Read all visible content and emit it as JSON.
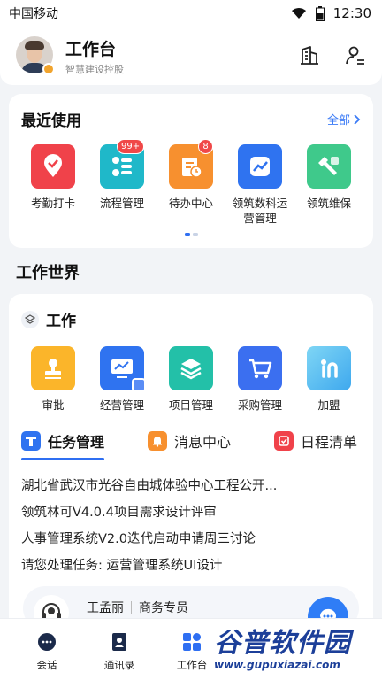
{
  "status_bar": {
    "carrier": "中国移动",
    "time": "12:30"
  },
  "header": {
    "title": "工作台",
    "subtitle": "智慧建设控股",
    "icons": [
      "building-switch-icon",
      "user-settings-icon"
    ]
  },
  "recent": {
    "title": "最近使用",
    "more_label": "全部",
    "apps": [
      {
        "label": "考勤打卡",
        "icon": "location-check-icon",
        "color": "#f0424a",
        "badge": ""
      },
      {
        "label": "流程管理",
        "icon": "flow-icon",
        "color": "#1fb8c9",
        "badge": "99+"
      },
      {
        "label": "待办中心",
        "icon": "clipboard-clock-icon",
        "color": "#f7902f",
        "badge": "8"
      },
      {
        "label": "领筑数科运营管理",
        "icon": "chart-icon",
        "color": "#2f73f0",
        "badge": ""
      },
      {
        "label": "领筑维保",
        "icon": "wrench-icon",
        "color": "#3fc98b",
        "badge": ""
      }
    ]
  },
  "work_world": {
    "title": "工作世界",
    "section_title": "工作",
    "apps": [
      {
        "label": "审批",
        "icon": "stamp-icon",
        "color": "#fbb52a"
      },
      {
        "label": "经营管理",
        "icon": "monitor-chart-icon",
        "color": "#2f73f0"
      },
      {
        "label": "项目管理",
        "icon": "layers-icon",
        "color": "#23c0a8"
      },
      {
        "label": "采购管理",
        "icon": "cart-icon",
        "color": "#3b6ff0"
      },
      {
        "label": "加盟",
        "icon": "join-icon",
        "color": "#5ec5f0"
      }
    ],
    "tabs": [
      {
        "label": "任务管理",
        "icon": "task-icon",
        "color": "#2f73f0",
        "active": true
      },
      {
        "label": "消息中心",
        "icon": "bell-icon",
        "color": "#f7902f",
        "active": false
      },
      {
        "label": "日程清单",
        "icon": "calendar-check-icon",
        "color": "#f0424a",
        "active": false
      }
    ],
    "tasks": [
      "湖北省武汉市光谷自由城体验中心工程公开...",
      "领筑林可V4.0.4项目需求设计评审",
      "人事管理系统V2.0迭代启动申请周三讨论",
      "请您处理任务: 运营管理系统UI设计"
    ]
  },
  "contact": {
    "name": "王孟丽",
    "role": "商务专员"
  },
  "bottom_nav": [
    {
      "label": "会话",
      "icon": "chat-icon",
      "active": false
    },
    {
      "label": "通讯录",
      "icon": "contacts-icon",
      "active": false
    },
    {
      "label": "工作台",
      "icon": "workbench-icon",
      "active": true
    }
  ],
  "watermark": {
    "main": "谷普软件园",
    "url": "www.gupuxiazai.com"
  },
  "colors": {
    "accent": "#2f6ff2",
    "background": "#f2f4f7"
  }
}
